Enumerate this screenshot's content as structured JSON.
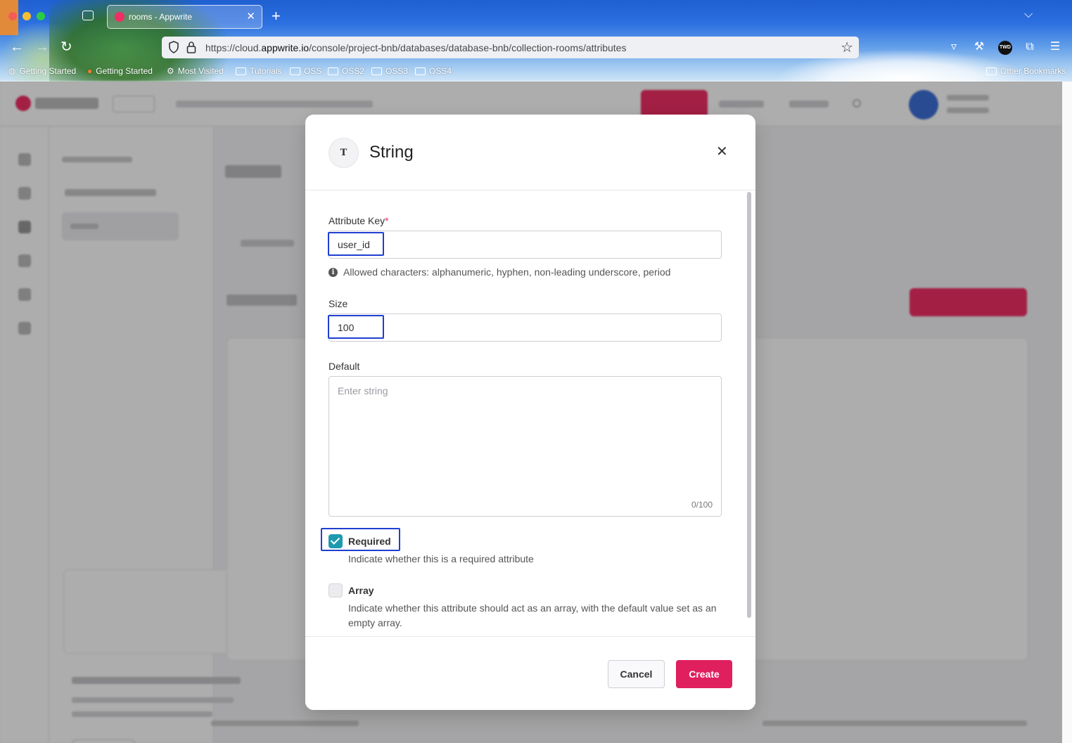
{
  "browser": {
    "tab_title": "rooms - Appwrite",
    "url_prefix": "https://cloud.",
    "url_domain": "appwrite.io",
    "url_path": "/console/project-bnb/databases/database-bnb/collection-rooms/attributes",
    "bookmarks": [
      "Getting Started",
      "Getting Started",
      "Most Visited",
      "Tutorials",
      "OSS",
      "OSS2",
      "OSS3",
      "OSS4"
    ],
    "other_bookmarks": "Other Bookmarks",
    "twd_badge": "TWD"
  },
  "modal": {
    "type_icon": "T",
    "title": "String",
    "attribute_key_label": "Attribute Key",
    "required_mark": "*",
    "attribute_key_value": "user_id",
    "allowed_hint": "Allowed characters: alphanumeric, hyphen, non-leading underscore, period",
    "size_label": "Size",
    "size_value": "100",
    "default_label": "Default",
    "default_placeholder": "Enter string",
    "char_count": "0/100",
    "required_label": "Required",
    "required_checked": true,
    "required_desc": "Indicate whether this is a required attribute",
    "array_label": "Array",
    "array_checked": false,
    "array_desc": "Indicate whether this attribute should act as an array, with the default value set as an empty array.",
    "cancel": "Cancel",
    "create": "Create"
  },
  "colors": {
    "accent": "#e01f5f",
    "checkbox_on": "#1e9ab0",
    "highlight": "#1f3fd1"
  }
}
